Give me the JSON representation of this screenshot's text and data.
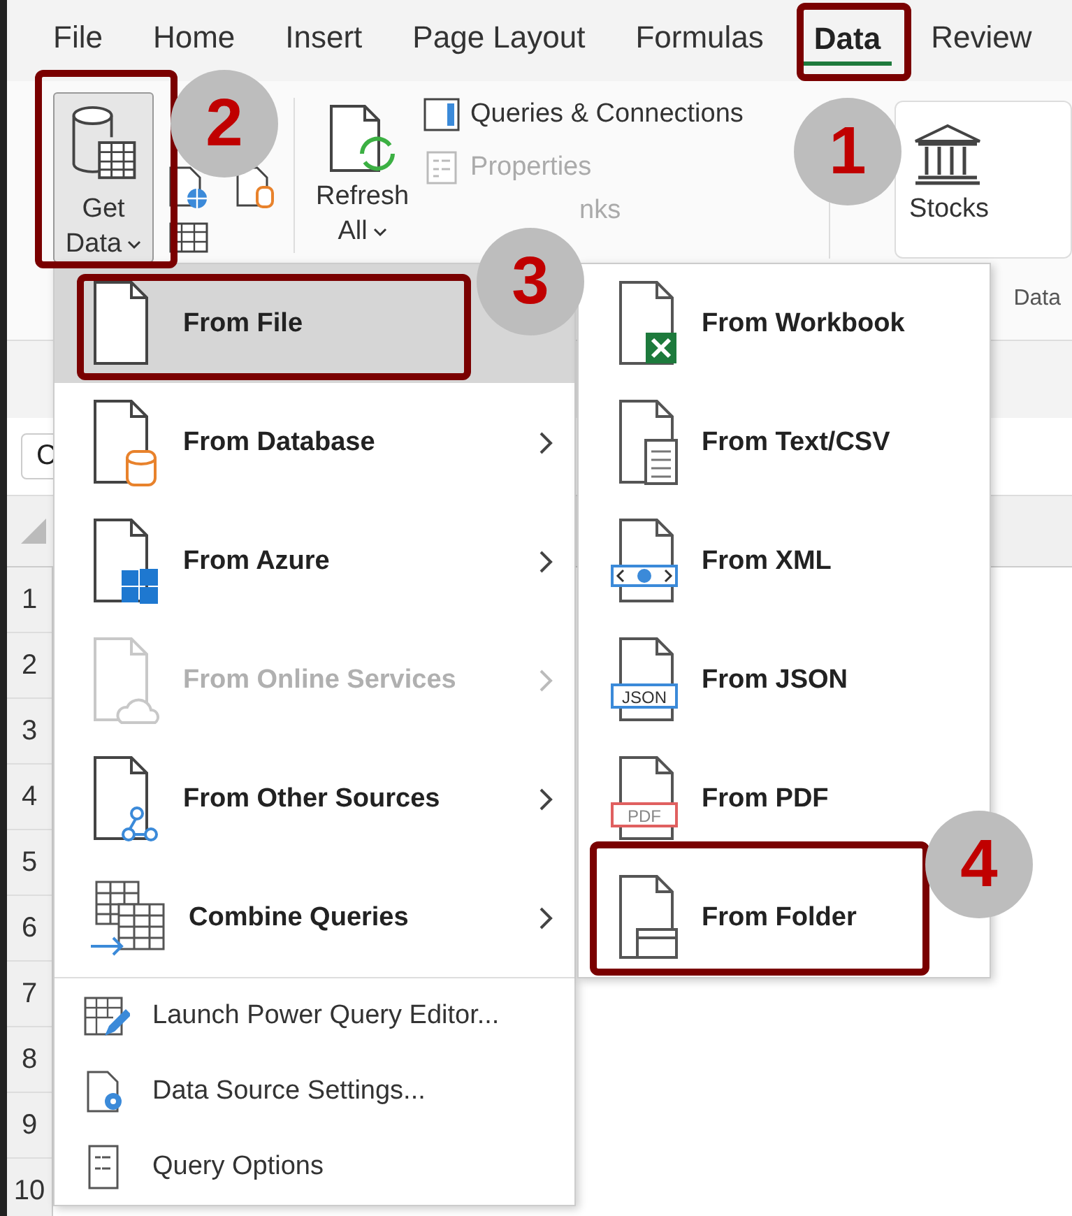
{
  "ribbon_tabs": [
    {
      "label": "File",
      "selected": false
    },
    {
      "label": "Home",
      "selected": false
    },
    {
      "label": "Insert",
      "selected": false
    },
    {
      "label": "Page Layout",
      "selected": false
    },
    {
      "label": "Formulas",
      "selected": false
    },
    {
      "label": "Data",
      "selected": true
    },
    {
      "label": "Review",
      "selected": false
    }
  ],
  "ribbon": {
    "get_data": {
      "lines": [
        "Get",
        "Data"
      ]
    },
    "refresh_all": {
      "lines": [
        "Refresh",
        "All"
      ]
    },
    "commands": [
      {
        "label": "Queries & Connections",
        "disabled": false
      },
      {
        "label": "Properties",
        "disabled": true
      },
      {
        "label": "nks",
        "disabled": true
      }
    ],
    "stocks": {
      "label": "Stocks"
    },
    "group_label": "Data"
  },
  "sheet": {
    "name_box": "C",
    "rows": [
      "1",
      "2",
      "3",
      "4",
      "5",
      "6",
      "7",
      "8",
      "9",
      "10"
    ]
  },
  "get_data_menu": {
    "items": [
      {
        "label": "From File",
        "selected": true,
        "disabled": false,
        "arrow": false
      },
      {
        "label": "From Database",
        "selected": false,
        "disabled": false,
        "arrow": true
      },
      {
        "label": "From Azure",
        "selected": false,
        "disabled": false,
        "arrow": true
      },
      {
        "label": "From Online Services",
        "selected": false,
        "disabled": true,
        "arrow": true
      },
      {
        "label": "From Other Sources",
        "selected": false,
        "disabled": false,
        "arrow": true
      },
      {
        "label": "Combine Queries",
        "selected": false,
        "disabled": false,
        "arrow": true
      }
    ],
    "commands": [
      {
        "label": "Launch Power Query Editor..."
      },
      {
        "label": "Data Source Settings..."
      },
      {
        "label": "Query Options"
      }
    ]
  },
  "from_file_menu": {
    "items": [
      {
        "label": "From Workbook"
      },
      {
        "label": "From Text/CSV"
      },
      {
        "label": "From XML"
      },
      {
        "label": "From JSON",
        "badge": "JSON"
      },
      {
        "label": "From PDF",
        "badge": "PDF"
      },
      {
        "label": "From Folder"
      }
    ]
  },
  "callouts": [
    {
      "number": "1"
    },
    {
      "number": "2"
    },
    {
      "number": "3"
    },
    {
      "number": "4"
    }
  ]
}
